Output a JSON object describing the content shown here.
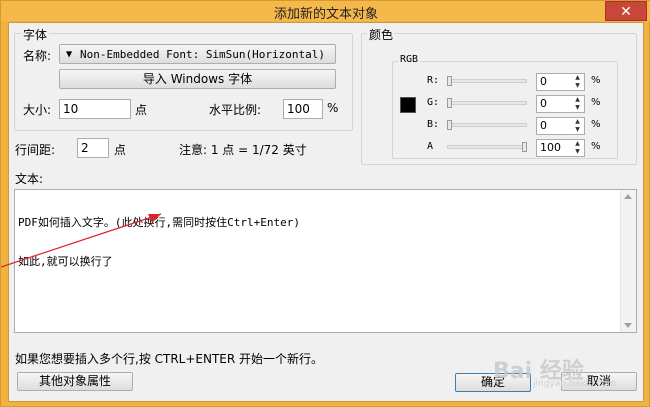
{
  "window": {
    "title": "添加新的文本对象",
    "close": "✕"
  },
  "font_group": {
    "label": "字体",
    "name_label": "名称:",
    "font_value": "Non-Embedded Font: SimSun(Horizontal)",
    "import_button": "导入 Windows 字体",
    "size_label": "大小:",
    "size_value": "10",
    "size_unit": "点",
    "hscale_label": "水平比例:",
    "hscale_value": "100",
    "hscale_unit": "%"
  },
  "color_group": {
    "label": "颜色",
    "rgb_label": "RGB",
    "swatch_color": "#000000",
    "channels": [
      {
        "label": "R:",
        "value": "0",
        "unit": "%",
        "level": 0
      },
      {
        "label": "G:",
        "value": "0",
        "unit": "%",
        "level": 0
      },
      {
        "label": "B:",
        "value": "0",
        "unit": "%",
        "level": 0
      },
      {
        "label": "A",
        "value": "100",
        "unit": "%",
        "level": 100
      }
    ]
  },
  "spacing": {
    "label": "行间距:",
    "value": "2",
    "unit": "点",
    "note": "注意: 1 点 = 1/72 英寸"
  },
  "text": {
    "label": "文本:",
    "lines": [
      "PDF如何插入文字。(此处换行,需同时按住Ctrl+Enter)",
      "如此,就可以换行了"
    ]
  },
  "hint": "如果您想要插入多个行,按 CTRL+ENTER 开始一个新行。",
  "buttons": {
    "other_props": "其他对象属性",
    "ok": "确定",
    "cancel": "取消"
  },
  "watermark": {
    "logo": "Bai  经验",
    "sub": "jingyan.baidu.com"
  },
  "annotation_color": "#d9262b"
}
